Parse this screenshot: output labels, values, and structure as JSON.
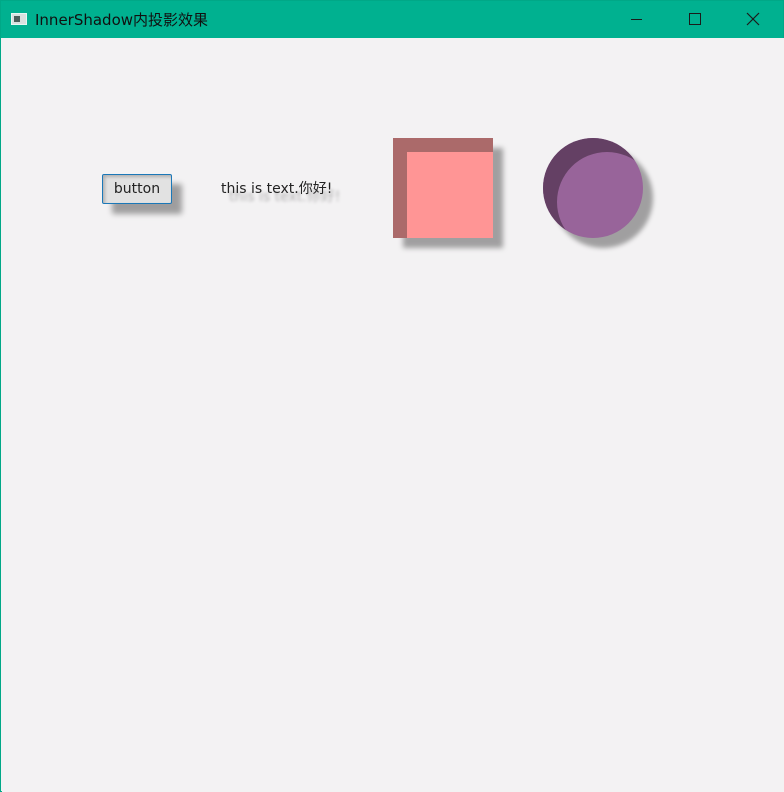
{
  "window": {
    "title": "InnerShadow内投影效果",
    "icon": "app-window-icon",
    "controls": [
      {
        "name": "minimize-icon"
      },
      {
        "name": "maximize-icon"
      },
      {
        "name": "close-icon"
      }
    ]
  },
  "content": {
    "button_label": "button",
    "text_label": "this is text.你好!",
    "square": {
      "color": "#ff9595",
      "inner_shadow_color": "#ab6a6a"
    },
    "circle": {
      "color": "#98649a",
      "inner_shadow_color": "#644064"
    }
  },
  "colors": {
    "titlebar": "#00b190",
    "background": "#f3f2f3",
    "button_border": "#1b78b8"
  }
}
